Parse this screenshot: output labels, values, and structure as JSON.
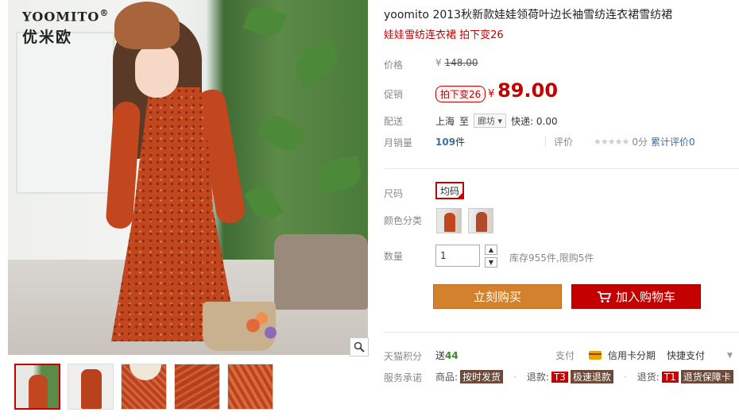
{
  "gallery": {
    "brand_en": "YOOMITO",
    "brand_reg": "®",
    "brand_cn": "优米欧",
    "zoom_icon": "magnifier-icon",
    "thumb_count": 5
  },
  "product": {
    "title": "yoomito 2013秋新款娃娃领荷叶边长袖雪纺连衣裙雪纺裙",
    "subtitle": "娃娃雪纺连衣裙 拍下变26"
  },
  "labels": {
    "price": "价格",
    "promo": "促销",
    "delivery": "配送",
    "monthly_sales": "月销量",
    "size": "尺码",
    "color": "颜色分类",
    "quantity": "数量",
    "points": "天猫积分",
    "promise": "服务承诺"
  },
  "price": {
    "currency": "¥",
    "original": "148.00",
    "promo_tag": "拍下变26",
    "current": "89.00"
  },
  "delivery": {
    "from": "上海",
    "to_word": "至",
    "destination": "廊坊",
    "dropdown_icon": "caret-down-icon",
    "express": "快递: 0.00"
  },
  "sales": {
    "count": "109",
    "unit": "件",
    "rating_label": "评价",
    "stars": "★★★★★",
    "score": "0分",
    "review_link": "累计评价0"
  },
  "options": {
    "size_value": "均码",
    "qty_value": "1",
    "qty_up": "▲",
    "qty_down": "▼",
    "stock": "库存955件,限购5件"
  },
  "buttons": {
    "buy_now": "立刻购买",
    "add_cart": "加入购物车"
  },
  "extras": {
    "points_prefix": "送",
    "points_value": "44",
    "pay_label": "支付",
    "credit": "信用卡分期",
    "quick_pay": "快捷支付",
    "chevron": "▼",
    "goods_label": "商品:",
    "goods_badge": "按时发货",
    "refund_label": "退款:",
    "refund_code": "T3",
    "refund_badge": "极速退款",
    "return_label": "退货:",
    "return_code": "T1",
    "return_badge": "退货保障卡",
    "dot": "·"
  },
  "colors": {
    "accent_red": "#c40000",
    "buy_orange": "#d4812e",
    "link_blue": "#3c6ea6",
    "points_green": "#3a8a2a"
  }
}
